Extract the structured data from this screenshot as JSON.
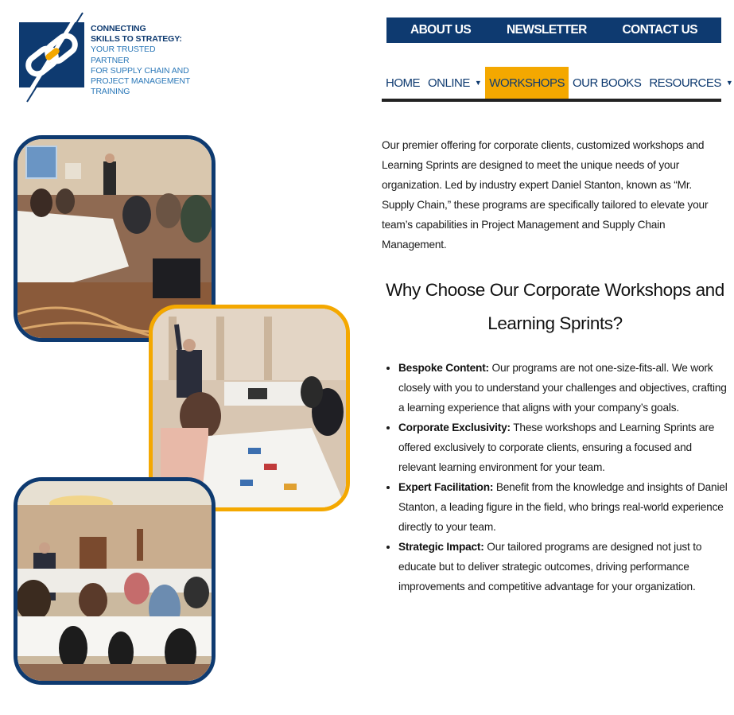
{
  "logo": {
    "line1": "CONNECTING",
    "line2": "SKILLS TO STRATEGY:",
    "line3": "YOUR TRUSTED PARTNER",
    "line4": "FOR SUPPLY CHAIN AND",
    "line5": "PROJECT MANAGEMENT",
    "line6": "TRAINING"
  },
  "topnav": {
    "about": "ABOUT US",
    "newsletter": "NEWSLETTER",
    "contact": "CONTACT US"
  },
  "mainnav": {
    "home": "HOME",
    "online": "ONLINE",
    "workshops": "WORKSHOPS",
    "books": "OUR BOOKS",
    "resources": "RESOURCES",
    "active": "WORKSHOPS"
  },
  "intro": "Our premier offering for corporate clients, customized workshops and Learning Sprints are designed to meet the unique needs of your organization. Led by industry expert Daniel Stanton, known as “Mr. Supply Chain,” these programs are specifically tailored to elevate your team’s capabilities in Project Management and Supply Chain Management.",
  "heading": "Why Choose Our Corporate Workshops and Learning Sprints?",
  "bullets": [
    {
      "lead": "Bespoke Content:",
      "text": " Our programs are not one-size-fits-all. We work closely with you to understand your challenges and objectives, crafting a learning experience that aligns with your company’s goals."
    },
    {
      "lead": "Corporate Exclusivity:",
      "text": " These workshops and Learning Sprints are offered exclusively to corporate clients, ensuring a focused and relevant learning environment for your team."
    },
    {
      "lead": "Expert Facilitation:",
      "text": " Benefit from the knowledge and insights of Daniel Stanton, a leading figure in the field, who brings real-world experience directly to your team."
    },
    {
      "lead": "Strategic Impact:",
      "text": " Our tailored programs are designed not just to educate but to deliver strategic outcomes, driving performance improvements and competitive advantage for your organization."
    }
  ],
  "colors": {
    "brand_navy": "#0e3a70",
    "brand_blue": "#2b78b8",
    "accent_gold": "#f4a800"
  }
}
